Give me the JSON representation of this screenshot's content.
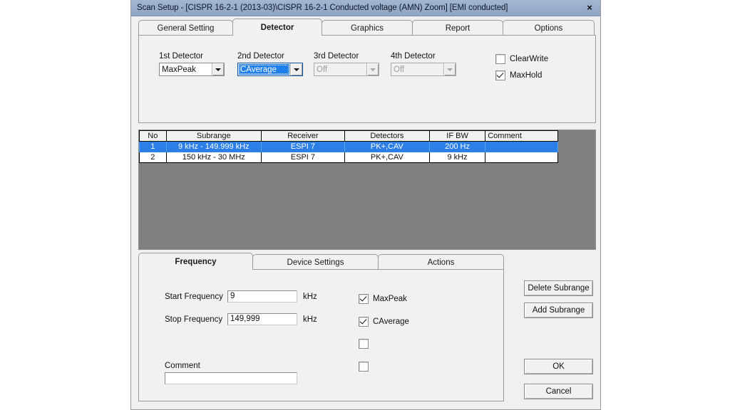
{
  "window": {
    "title": "Scan Setup - [CISPR 16-2-1 (2013-03)\\CISPR 16-2-1 Conducted voltage (AMN) Zoom] [EMI conducted]",
    "close_label": "×",
    "titlebar_color": "#93a9c8"
  },
  "tabs": [
    {
      "label": "General Setting",
      "active": false
    },
    {
      "label": "Detector",
      "active": true
    },
    {
      "label": "Graphics",
      "active": false
    },
    {
      "label": "Report",
      "active": false
    },
    {
      "label": "Options",
      "active": false
    }
  ],
  "detectors": [
    {
      "label": "1st Detector",
      "value": "MaxPeak",
      "state": "enabled"
    },
    {
      "label": "2nd Detector",
      "value": "CAverage",
      "state": "focused"
    },
    {
      "label": "3rd Detector",
      "value": "Off",
      "state": "disabled"
    },
    {
      "label": "4th Detector",
      "value": "Off",
      "state": "disabled"
    }
  ],
  "trace_options": [
    {
      "label": "ClearWrite",
      "checked": false
    },
    {
      "label": "MaxHold",
      "checked": true
    }
  ],
  "table": {
    "columns": [
      "No",
      "Subrange",
      "Receiver",
      "Detectors",
      "IF BW",
      "Comment"
    ],
    "rows": [
      {
        "no": "1",
        "subrange": "9 kHz - 149.999 kHz",
        "receiver": "ESPI 7",
        "detectors": "PK+,CAV",
        "ifbw": "200 Hz",
        "comment": "",
        "selected": true
      },
      {
        "no": "2",
        "subrange": "150 kHz - 30 MHz",
        "receiver": "ESPI 7",
        "detectors": "PK+,CAV",
        "ifbw": "9 kHz",
        "comment": "",
        "selected": false
      }
    ],
    "selection_color": "#2d7fe8",
    "background_color": "#808080"
  },
  "bottom_tabs": [
    {
      "label": "Frequency",
      "active": true
    },
    {
      "label": "Device Settings",
      "active": false
    },
    {
      "label": "Actions",
      "active": false
    }
  ],
  "frequency": {
    "start_label": "Start Frequency",
    "start_value": "9",
    "start_unit": "kHz",
    "stop_label": "Stop Frequency",
    "stop_value": "149,999",
    "stop_unit": "kHz",
    "comment_label": "Comment",
    "comment_value": ""
  },
  "detector_checks": [
    {
      "label": "MaxPeak",
      "checked": true
    },
    {
      "label": "CAverage",
      "checked": true
    },
    {
      "label": "",
      "checked": false
    },
    {
      "label": "",
      "checked": false
    }
  ],
  "buttons": {
    "delete_subrange": "Delete Subrange",
    "add_subrange": "Add Subrange",
    "ok": "OK",
    "cancel": "Cancel"
  }
}
